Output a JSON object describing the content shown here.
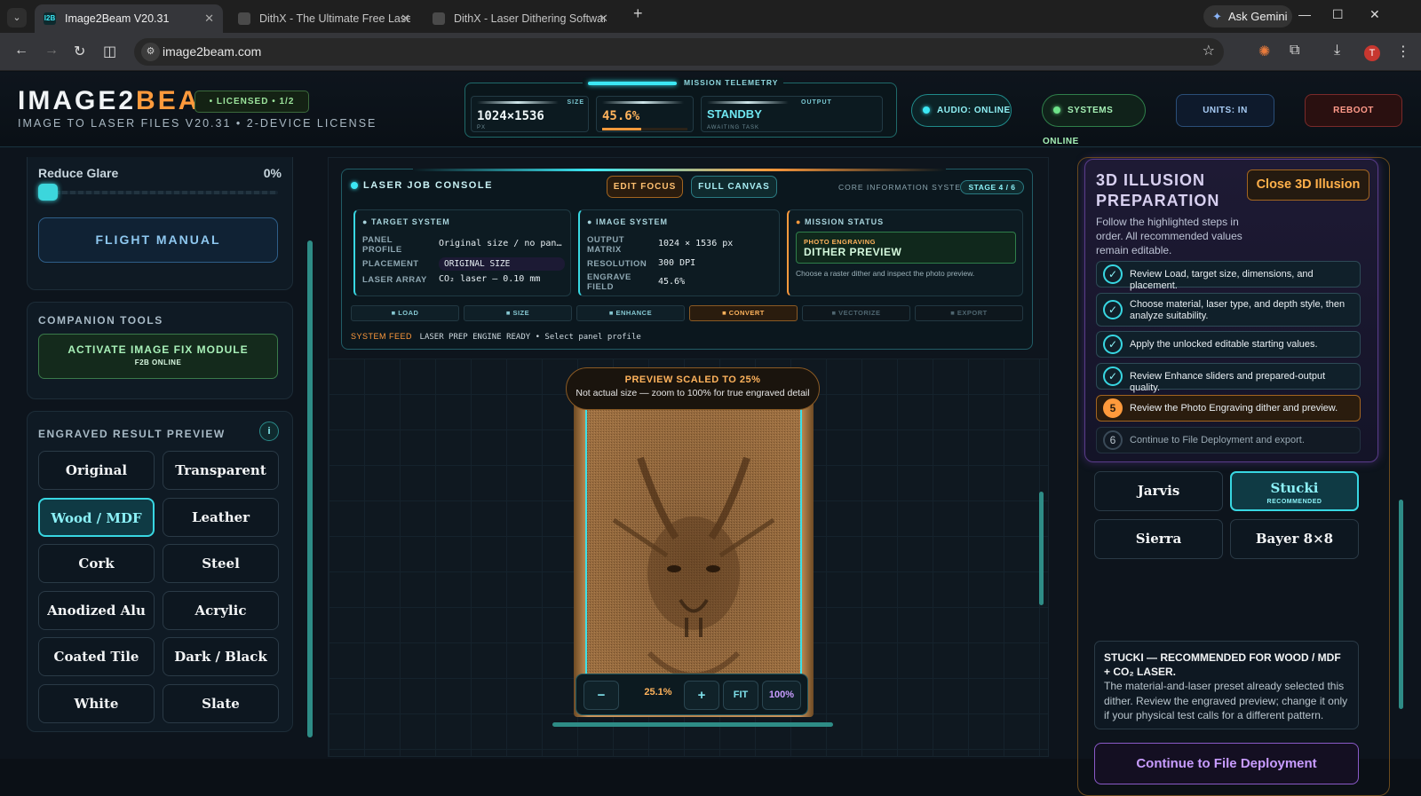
{
  "browser": {
    "tabs": [
      {
        "title": "Image2Beam V20.31",
        "favicon": "I2B"
      },
      {
        "title": "DithX - The Ultimate Free Laser"
      },
      {
        "title": "DithX - Laser Dithering Software"
      }
    ],
    "ask_gemini": "Ask Gemini",
    "url": "image2beam.com",
    "profile_initial": "T"
  },
  "header": {
    "logo_main": "IMAGE2",
    "logo_accent": "BEAM",
    "license_badge": "• LICENSED • 1/2",
    "subtitle": "IMAGE TO LASER FILES V20.31 • 2-DEVICE LICENSE",
    "telemetry": {
      "title": "MISSION TELEMETRY",
      "size_label": "SIZE",
      "size_value": "1024×1536",
      "size_unit": "PX",
      "progress_value": "45.6%",
      "output_label": "OUTPUT",
      "output_value": "STANDBY",
      "output_sub": "AWAITING TASK"
    },
    "audio": "AUDIO: ONLINE",
    "systems": "SYSTEMS ONLINE",
    "units": "UNITS: IN",
    "reboot": "REBOOT"
  },
  "left": {
    "glare_label": "Reduce Glare",
    "glare_value": "0%",
    "glare_level": 0,
    "flight_manual": "FLIGHT MANUAL",
    "companion_title": "COMPANION TOOLS",
    "fix_module": "ACTIVATE IMAGE FIX MODULE",
    "fix_module_sub": "F2B ONLINE",
    "preview_title": "ENGRAVED RESULT PREVIEW",
    "info_icon": "i",
    "materials": [
      "Original",
      "Transparent",
      "Wood / MDF",
      "Leather",
      "Cork",
      "Steel",
      "Anodized Alu",
      "Acrylic",
      "Coated Tile",
      "Dark / Black",
      "White",
      "Slate"
    ],
    "selected_material": "Wood / MDF"
  },
  "console": {
    "title": "LASER JOB CONSOLE",
    "edit_focus": "EDIT FOCUS",
    "full_canvas": "FULL CANVAS",
    "core_label": "CORE INFORMATION SYSTEM",
    "stage": "STAGE 4 / 6",
    "target": {
      "heading": "TARGET SYSTEM",
      "panel_profile_label": "PANEL PROFILE",
      "panel_profile_value": "Original size / no pan…",
      "placement_label": "PLACEMENT",
      "placement_value": "ORIGINAL SIZE",
      "laser_array_label": "LASER ARRAY",
      "laser_array_value": "CO₂ laser — 0.10 mm"
    },
    "image": {
      "heading": "IMAGE SYSTEM",
      "matrix_label": "OUTPUT MATRIX",
      "matrix_value": "1024 × 1536 px",
      "resolution_label": "RESOLUTION",
      "resolution_value": "300 DPI",
      "field_label": "ENGRAVE FIELD",
      "field_value": "45.6%"
    },
    "mission": {
      "heading": "MISSION STATUS",
      "kicker": "PHOTO ENGRAVING",
      "status": "DITHER PREVIEW",
      "hint": "Choose a raster dither and inspect the photo preview."
    },
    "steps": [
      "LOAD",
      "SIZE",
      "ENHANCE",
      "CONVERT",
      "VECTORIZE",
      "EXPORT"
    ],
    "current_step": "CONVERT",
    "feed_label": "SYSTEM FEED",
    "feed_text": "LASER PREP ENGINE READY • Select panel profile"
  },
  "preview": {
    "scaled_title": "PREVIEW SCALED TO 25%",
    "scaled_note": "Not actual size — zoom to 100% for true engraved detail",
    "zoom_minus": "−",
    "zoom_value": "25.1%",
    "zoom_plus": "+",
    "fit": "FIT",
    "hundred": "100%"
  },
  "right": {
    "title": "3D ILLUSION PREPARATION",
    "close": "Close 3D Illusion",
    "desc": "Follow the highlighted steps in order. All recommended values remain editable.",
    "checklist": [
      {
        "mark": "✓",
        "text": "Review Load, target size, dimensions, and placement."
      },
      {
        "mark": "✓",
        "text": "Choose material, laser type, and depth style, then analyze suitability."
      },
      {
        "mark": "✓",
        "text": "Apply the unlocked editable starting values."
      },
      {
        "mark": "✓",
        "text": "Review Enhance sliders and prepared-output quality."
      },
      {
        "mark": "5",
        "text": "Review the Photo Engraving dither and preview."
      },
      {
        "mark": "6",
        "text": "Continue to File Deployment and export."
      }
    ],
    "algos": [
      "Jarvis",
      "Stucki",
      "Sierra",
      "Bayer 8×8"
    ],
    "recommended_tag": "RECOMMENDED",
    "selected_algo": "Stucki",
    "note_title": "STUCKI — RECOMMENDED FOR WOOD / MDF + CO₂ LASER.",
    "note_body": "The material-and-laser preset already selected this dither. Review the engraved preview; change it only if your physical test calls for a different pattern.",
    "continue": "Continue to File Deployment"
  },
  "colors": {
    "accent_cyan": "#38d7e2",
    "accent_orange": "#ff9a3c",
    "purple": "#8a5ac8",
    "wood": "#b8864f"
  }
}
